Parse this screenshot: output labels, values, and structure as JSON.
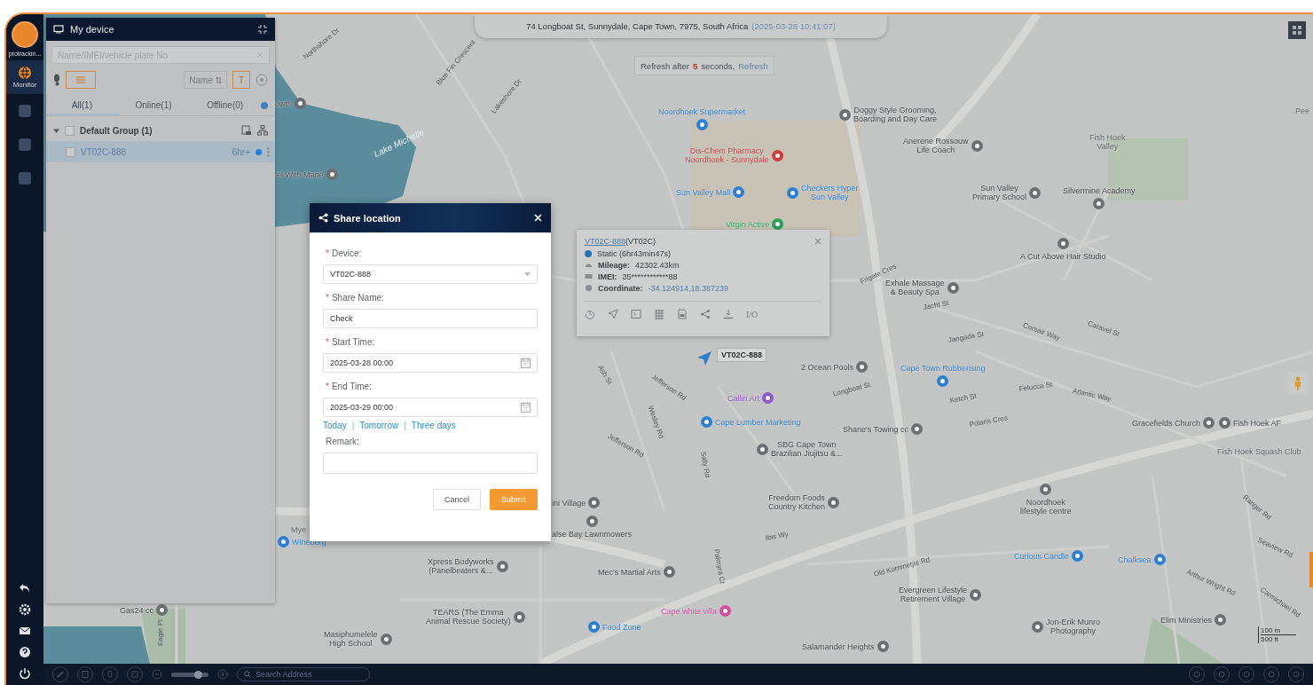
{
  "rail": {
    "brand": "protrackin...",
    "nav": [
      {
        "label": "Monitor",
        "selected": true
      },
      {
        "selected": false
      },
      {
        "selected": false
      },
      {
        "selected": false
      }
    ]
  },
  "device_panel": {
    "title": "My device",
    "search": {
      "placeholder": "Name/IMEI/vehicle plate No"
    },
    "sort_label": "Name",
    "text_toggle": "T",
    "tabs": [
      {
        "label": "All(1)",
        "selected": true
      },
      {
        "label": "Online(1)",
        "selected": false
      },
      {
        "label": "Offline(0)",
        "selected": false
      }
    ],
    "groups": [
      {
        "name": "Default Group (1)",
        "expanded": true,
        "checked": false,
        "devices": [
          {
            "name": "VT02C-888",
            "duration": "6hr+",
            "checked": false,
            "selected": true,
            "color": "#1e7fd8"
          }
        ]
      }
    ]
  },
  "address_bar": {
    "address": "74 Longboat St, Sunnydale, Cape Town, 7975, South Africa",
    "time": "(2025-03-28 10:41:07)"
  },
  "refresh_notice": {
    "before": "Refresh after",
    "count": "5",
    "after": "seconds,",
    "link": "Refresh"
  },
  "map": {
    "places": [
      {
        "text": "owth",
        "kind": "poi",
        "color": "#6b6f72"
      },
      {
        "text": "Noordhoek Supermarket",
        "kind": "poi",
        "color": "#2e7fd0"
      },
      {
        "text": "Doggy Style Grooming,\nBoarding and Day Care",
        "kind": "poi",
        "color": "#6b6f72"
      },
      {
        "text": "Pee",
        "kind": "area"
      },
      {
        "text": "Lake Michelle",
        "kind": "water"
      },
      {
        "text": "Dis-Chem Pharmacy\nNoordhoek - Sunnydale",
        "kind": "poi",
        "color": "#d03a3a"
      },
      {
        "text": "Anerene Rossouw\nLife Coach",
        "kind": "poi",
        "color": "#6b6f72"
      },
      {
        "text": "Fish Hoek\nValley",
        "kind": "area"
      },
      {
        "text": "el With Marie",
        "kind": "poi",
        "color": "#6b6f72"
      },
      {
        "text": "Sun Valley Mall",
        "kind": "poi",
        "color": "#2e7fd0"
      },
      {
        "text": "Checkers Hyper\nSun Valley",
        "kind": "poi",
        "color": "#2e7fd0"
      },
      {
        "text": "Sun Valley\nPrimary School",
        "kind": "poi",
        "color": "#6b6f72"
      },
      {
        "text": "Silvermine Academy",
        "kind": "poi",
        "color": "#6b6f72"
      },
      {
        "text": "Virgin Active",
        "kind": "poi",
        "color": "#2e9e5a"
      },
      {
        "text": "A Cut Above Hair Studio",
        "kind": "poi",
        "color": "#6b6f72"
      },
      {
        "text": "Exhale Massage\n& Beauty Spa",
        "kind": "poi",
        "color": "#6b6f72"
      },
      {
        "text": "2 Ocean Pools",
        "kind": "poi",
        "color": "#6b6f72"
      },
      {
        "text": "Cape Town Rubberising",
        "kind": "poi",
        "color": "#2e7fd0"
      },
      {
        "text": "Callin Art",
        "kind": "poi",
        "color": "#8e5ac8"
      },
      {
        "text": "Cape Lumber Marketing",
        "kind": "poi",
        "color": "#2e7fd0"
      },
      {
        "text": "Shane's Towing cc",
        "kind": "poi",
        "color": "#6b6f72"
      },
      {
        "text": "Gracefields Church",
        "kind": "poi",
        "color": "#6b6f72"
      },
      {
        "text": "Fish Hoek AF",
        "kind": "poi",
        "color": "#6b6f72"
      },
      {
        "text": "SBG Cape Town\nBrazilian Jiujitsu &...",
        "kind": "poi",
        "color": "#6b6f72"
      },
      {
        "text": "Fish Hoek Squash Club",
        "kind": "area"
      },
      {
        "text": "ini Village",
        "kind": "poi",
        "color": "#6b6f72"
      },
      {
        "text": "Freedom Foods\nCountry Kitchen",
        "kind": "poi",
        "color": "#6b6f72"
      },
      {
        "text": "Noordhoek\nlifestyle centre",
        "kind": "poi",
        "color": "#6b6f72"
      },
      {
        "text": "Mye",
        "kind": "area"
      },
      {
        "text": "Wineberg",
        "kind": "poi",
        "color": "#2e7fd0"
      },
      {
        "text": "alse Bay Lawnmowers",
        "kind": "poi",
        "color": "#6b6f72"
      },
      {
        "text": "Xpress Bodyworks\n(Panelbeaters &...",
        "kind": "poi",
        "color": "#6b6f72"
      },
      {
        "text": "Mec's Martial Arts",
        "kind": "poi",
        "color": "#6b6f72"
      },
      {
        "text": "Curious Candle",
        "kind": "poi",
        "color": "#2e7fd0"
      },
      {
        "text": "Chalksea",
        "kind": "poi",
        "color": "#2e7fd0"
      },
      {
        "text": "Evergreen Lifestyle\nRetirement Village",
        "kind": "poi",
        "color": "#6b6f72"
      },
      {
        "text": "Gas24 cc",
        "kind": "poi",
        "color": "#6b6f72"
      },
      {
        "text": "TEARS (The Emma\nAnimal Rescue Society)",
        "kind": "poi",
        "color": "#6b6f72"
      },
      {
        "text": "Food Zone",
        "kind": "poi",
        "color": "#2e7fd0"
      },
      {
        "text": "Cape white villa",
        "kind": "poi",
        "color": "#d44ea0"
      },
      {
        "text": "Jon-Erik Munro\nPhotography",
        "kind": "poi",
        "color": "#6b6f72"
      },
      {
        "text": "Elim Ministries",
        "kind": "poi",
        "color": "#6b6f72"
      },
      {
        "text": "Masiphumelele\nHigh School",
        "kind": "poi",
        "color": "#6b6f72"
      },
      {
        "text": "Salamander Heights",
        "kind": "poi",
        "color": "#6b6f72"
      }
    ],
    "streets": [
      "Northshore Dr",
      "Blue Fin Crescent",
      "Lakeshore Dr",
      "Frigate Cres",
      "Jacht St",
      "Jangada St",
      "Caravel St",
      "Corsair Way",
      "Jefferson Rd",
      "Ash St",
      "Longboat St",
      "Ketch St",
      "Felucca St",
      "Atlantic Way",
      "Polaris Cres",
      "Wesley Rd",
      "Jefferson Rd",
      "Sally Rd",
      "Palmyra Ct",
      "Ibis Wy",
      "Old Kommetjie Rd",
      "Ranger Rd",
      "Seaview Rd",
      "Arthur Wright Rd",
      "Carmichael Rd",
      "Eagle Pl"
    ],
    "scale": {
      "metric": "100 m",
      "imperial": "500 ft"
    }
  },
  "vehicle": {
    "label": "VT02C-888"
  },
  "popup": {
    "name": "VT02C-888",
    "model": "(VT02C)",
    "status": "Static (6hr43min47s)",
    "fields": [
      {
        "label": "Mileage:",
        "value": "42302.43km",
        "kind": "text"
      },
      {
        "label": "IMEI:",
        "value": "35************88",
        "kind": "text"
      },
      {
        "label": "Coordinate:",
        "value": "-34.124914,18.387239",
        "kind": "link"
      }
    ],
    "io_label": "I/O"
  },
  "dialog": {
    "title": "Share location",
    "fields": [
      {
        "label": "Device:",
        "required_mark": "*",
        "kind": "select",
        "value": "VT02C-888"
      },
      {
        "label": "Share Name:",
        "required_mark": "*",
        "kind": "text",
        "value": "Check"
      },
      {
        "label": "Start Time:",
        "required_mark": "*",
        "kind": "date",
        "value": "2025-03-28 00:00"
      },
      {
        "label": "End Time:",
        "required_mark": "*",
        "kind": "date",
        "value": "2025-03-29 00:00",
        "shortcuts": [
          {
            "kind": "link",
            "text": "Today"
          },
          {
            "kind": "separator",
            "text": "|"
          },
          {
            "kind": "link",
            "text": "Tomorrow"
          },
          {
            "kind": "separator",
            "text": "|"
          },
          {
            "kind": "link",
            "text": "Three days"
          }
        ]
      },
      {
        "label": "Remark:",
        "kind": "textarea"
      }
    ],
    "buttons": [
      {
        "label": "Cancel",
        "kind": "secondary"
      },
      {
        "label": "Submit",
        "kind": "primary"
      }
    ]
  },
  "bottom_bar": {
    "zoom": {
      "level": 0.72
    },
    "search": {
      "placeholder": "Search Address"
    }
  }
}
